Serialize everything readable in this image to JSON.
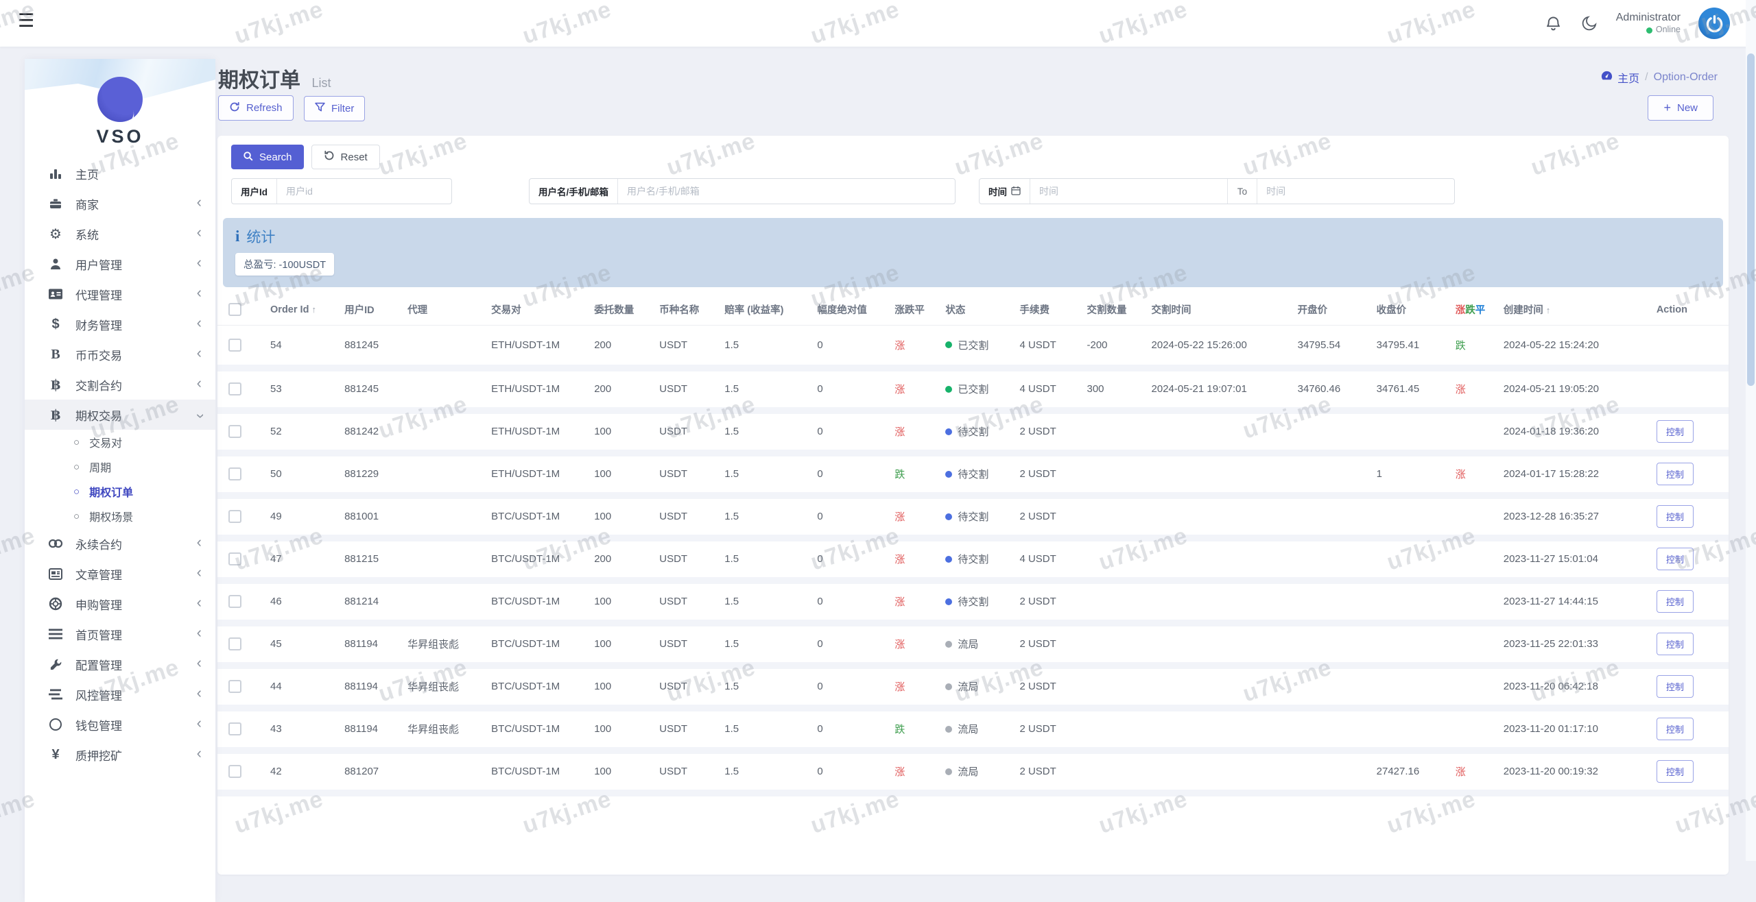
{
  "watermark": {
    "text": "u7kj.me"
  },
  "topbar": {
    "menu_icon": "hamburger",
    "user": {
      "name": "Administrator",
      "status": "Online"
    }
  },
  "sidebar": {
    "logo": "VSO",
    "items": [
      {
        "icon": "chart",
        "label": "主页",
        "chevron": false
      },
      {
        "icon": "merchant",
        "label": "商家",
        "chevron": true
      },
      {
        "icon": "gear",
        "label": "系统",
        "chevron": true
      },
      {
        "icon": "user",
        "label": "用户管理",
        "chevron": true
      },
      {
        "icon": "idcard",
        "label": "代理管理",
        "chevron": true
      },
      {
        "icon": "dollar",
        "label": "财务管理",
        "chevron": true
      },
      {
        "icon": "bigb",
        "label": "币币交易",
        "chevron": true
      },
      {
        "icon": "bitcoin",
        "label": "交割合约",
        "chevron": true
      },
      {
        "icon": "bitcoin",
        "label": "期权交易",
        "chevron": true,
        "expanded": true,
        "submenu": [
          {
            "label": "交易对"
          },
          {
            "label": "周期"
          },
          {
            "label": "期权订单",
            "active": true
          },
          {
            "label": "期权场景"
          }
        ]
      },
      {
        "icon": "link",
        "label": "永续合约",
        "chevron": true
      },
      {
        "icon": "article",
        "label": "文章管理",
        "chevron": true
      },
      {
        "icon": "lifebuoy",
        "label": "申购管理",
        "chevron": true
      },
      {
        "icon": "list",
        "label": "首页管理",
        "chevron": true
      },
      {
        "icon": "wrench",
        "label": "配置管理",
        "chevron": true
      },
      {
        "icon": "risk",
        "label": "风控管理",
        "chevron": true
      },
      {
        "icon": "circle",
        "label": "钱包管理",
        "chevron": true
      },
      {
        "icon": "yen",
        "label": "质押挖矿",
        "chevron": true
      }
    ]
  },
  "page": {
    "title": "期权订单",
    "subtitle": "List",
    "breadcrumb": {
      "home": "主页",
      "separator": "/",
      "current": "Option-Order"
    }
  },
  "toolbar": {
    "refresh_label": "Refresh",
    "filter_label": "Filter",
    "new_label": "New",
    "new_plus": "+"
  },
  "search": {
    "search_label": "Search",
    "reset_label": "Reset",
    "user_id": {
      "label": "用户Id",
      "placeholder": "用户id",
      "value": ""
    },
    "user_name": {
      "label": "用户名/手机/邮箱",
      "placeholder": "用户名/手机/邮箱",
      "value": ""
    },
    "time": {
      "label": "时间",
      "placeholder_from": "时间",
      "to": "To",
      "placeholder_to": "时间",
      "value_from": "",
      "value_to": ""
    }
  },
  "stats": {
    "title": "统计",
    "total": "总盈亏: -100USDT"
  },
  "table": {
    "headers": [
      {
        "type": "checkbox",
        "label": ""
      },
      {
        "label": "Order Id",
        "sort": "↑"
      },
      {
        "label": "用户ID"
      },
      {
        "label": "代理"
      },
      {
        "label": "交易对"
      },
      {
        "label": "委托数量"
      },
      {
        "label": "币种名称"
      },
      {
        "label": "赔率 (收益率)"
      },
      {
        "label": "幅度绝对值"
      },
      {
        "label": "涨跌平"
      },
      {
        "label": "状态"
      },
      {
        "label": "手续费"
      },
      {
        "label": "交割数量"
      },
      {
        "label": "交割时间"
      },
      {
        "label": "开盘价"
      },
      {
        "label": "收盘价"
      },
      {
        "label": "涨跌平",
        "colored": [
          "涨",
          "跌",
          "平"
        ]
      },
      {
        "label": "创建时间",
        "sort": "↑"
      },
      {
        "label": "Action"
      }
    ],
    "action_label": "控制",
    "rows": [
      {
        "order_id": "54",
        "user_id": "881245",
        "agent": "",
        "pair": "ETH/USDT-1M",
        "qty": "200",
        "coin": "USDT",
        "odds": "1.5",
        "amplitude": "0",
        "direction": {
          "text": "涨",
          "dir": "up"
        },
        "status": {
          "text": "已交割",
          "type": "done"
        },
        "fee": "4 USDT",
        "delivery_qty": "-200",
        "delivery_time": "2024-05-22 15:26:00",
        "open_price": "34795.54",
        "close_price": "34795.41",
        "result": {
          "text": "跌",
          "dir": "down"
        },
        "created": "2024-05-22 15:24:20",
        "has_action": false
      },
      {
        "order_id": "53",
        "user_id": "881245",
        "agent": "",
        "pair": "ETH/USDT-1M",
        "qty": "200",
        "coin": "USDT",
        "odds": "1.5",
        "amplitude": "0",
        "direction": {
          "text": "涨",
          "dir": "up"
        },
        "status": {
          "text": "已交割",
          "type": "done"
        },
        "fee": "4 USDT",
        "delivery_qty": "300",
        "delivery_time": "2024-05-21 19:07:01",
        "open_price": "34760.46",
        "close_price": "34761.45",
        "result": {
          "text": "涨",
          "dir": "up"
        },
        "created": "2024-05-21 19:05:20",
        "has_action": false
      },
      {
        "order_id": "52",
        "user_id": "881242",
        "agent": "",
        "pair": "ETH/USDT-1M",
        "qty": "100",
        "coin": "USDT",
        "odds": "1.5",
        "amplitude": "0",
        "direction": {
          "text": "涨",
          "dir": "up"
        },
        "status": {
          "text": "待交割",
          "type": "pending"
        },
        "fee": "2 USDT",
        "delivery_qty": "",
        "delivery_time": "",
        "open_price": "",
        "close_price": "",
        "result": {
          "text": "",
          "dir": ""
        },
        "created": "2024-01-18 19:36:20",
        "has_action": true
      },
      {
        "order_id": "50",
        "user_id": "881229",
        "agent": "",
        "pair": "ETH/USDT-1M",
        "qty": "100",
        "coin": "USDT",
        "odds": "1.5",
        "amplitude": "0",
        "direction": {
          "text": "跌",
          "dir": "down"
        },
        "status": {
          "text": "待交割",
          "type": "pending"
        },
        "fee": "2 USDT",
        "delivery_qty": "",
        "delivery_time": "",
        "open_price": "",
        "close_price": "1",
        "result": {
          "text": "涨",
          "dir": "up"
        },
        "created": "2024-01-17 15:28:22",
        "has_action": true
      },
      {
        "order_id": "49",
        "user_id": "881001",
        "agent": "",
        "pair": "BTC/USDT-1M",
        "qty": "100",
        "coin": "USDT",
        "odds": "1.5",
        "amplitude": "0",
        "direction": {
          "text": "涨",
          "dir": "up"
        },
        "status": {
          "text": "待交割",
          "type": "pending"
        },
        "fee": "2 USDT",
        "delivery_qty": "",
        "delivery_time": "",
        "open_price": "",
        "close_price": "",
        "result": {
          "text": "",
          "dir": ""
        },
        "created": "2023-12-28 16:35:27",
        "has_action": true
      },
      {
        "order_id": "47",
        "user_id": "881215",
        "agent": "",
        "pair": "BTC/USDT-1M",
        "qty": "200",
        "coin": "USDT",
        "odds": "1.5",
        "amplitude": "0",
        "direction": {
          "text": "涨",
          "dir": "up"
        },
        "status": {
          "text": "待交割",
          "type": "pending"
        },
        "fee": "4 USDT",
        "delivery_qty": "",
        "delivery_time": "",
        "open_price": "",
        "close_price": "",
        "result": {
          "text": "",
          "dir": ""
        },
        "created": "2023-11-27 15:01:04",
        "has_action": true
      },
      {
        "order_id": "46",
        "user_id": "881214",
        "agent": "",
        "pair": "BTC/USDT-1M",
        "qty": "100",
        "coin": "USDT",
        "odds": "1.5",
        "amplitude": "0",
        "direction": {
          "text": "涨",
          "dir": "up"
        },
        "status": {
          "text": "待交割",
          "type": "pending"
        },
        "fee": "2 USDT",
        "delivery_qty": "",
        "delivery_time": "",
        "open_price": "",
        "close_price": "",
        "result": {
          "text": "",
          "dir": ""
        },
        "created": "2023-11-27 14:44:15",
        "has_action": true
      },
      {
        "order_id": "45",
        "user_id": "881194",
        "agent": "华昇组丧彪",
        "pair": "BTC/USDT-1M",
        "qty": "100",
        "coin": "USDT",
        "odds": "1.5",
        "amplitude": "0",
        "direction": {
          "text": "涨",
          "dir": "up"
        },
        "status": {
          "text": "流局",
          "type": "void"
        },
        "fee": "2 USDT",
        "delivery_qty": "",
        "delivery_time": "",
        "open_price": "",
        "close_price": "",
        "result": {
          "text": "",
          "dir": ""
        },
        "created": "2023-11-25 22:01:33",
        "has_action": true
      },
      {
        "order_id": "44",
        "user_id": "881194",
        "agent": "华昇组丧彪",
        "pair": "BTC/USDT-1M",
        "qty": "100",
        "coin": "USDT",
        "odds": "1.5",
        "amplitude": "0",
        "direction": {
          "text": "涨",
          "dir": "up"
        },
        "status": {
          "text": "流局",
          "type": "void"
        },
        "fee": "2 USDT",
        "delivery_qty": "",
        "delivery_time": "",
        "open_price": "",
        "close_price": "",
        "result": {
          "text": "",
          "dir": ""
        },
        "created": "2023-11-20 06:42:18",
        "has_action": true
      },
      {
        "order_id": "43",
        "user_id": "881194",
        "agent": "华昇组丧彪",
        "pair": "BTC/USDT-1M",
        "qty": "100",
        "coin": "USDT",
        "odds": "1.5",
        "amplitude": "0",
        "direction": {
          "text": "跌",
          "dir": "down"
        },
        "status": {
          "text": "流局",
          "type": "void"
        },
        "fee": "2 USDT",
        "delivery_qty": "",
        "delivery_time": "",
        "open_price": "",
        "close_price": "",
        "result": {
          "text": "",
          "dir": ""
        },
        "created": "2023-11-20 01:17:10",
        "has_action": true
      },
      {
        "order_id": "42",
        "user_id": "881207",
        "agent": "",
        "pair": "BTC/USDT-1M",
        "qty": "100",
        "coin": "USDT",
        "odds": "1.5",
        "amplitude": "0",
        "direction": {
          "text": "涨",
          "dir": "up"
        },
        "status": {
          "text": "流局",
          "type": "void"
        },
        "fee": "2 USDT",
        "delivery_qty": "",
        "delivery_time": "",
        "open_price": "",
        "close_price": "27427.16",
        "result": {
          "text": "涨",
          "dir": "up"
        },
        "created": "2023-11-20 00:19:32",
        "has_action": true
      }
    ]
  },
  "colors": {
    "accent": "#545fd3",
    "stats_band": "#c9d8ea",
    "up_red": "#e05a5a",
    "down_green": "#3f9e4f",
    "flat_blue": "#1c7ed6",
    "status_done": "#17b26a",
    "status_pending": "#4c6fe0",
    "status_void": "#a9aeb6",
    "online_green": "#2ebd71"
  }
}
